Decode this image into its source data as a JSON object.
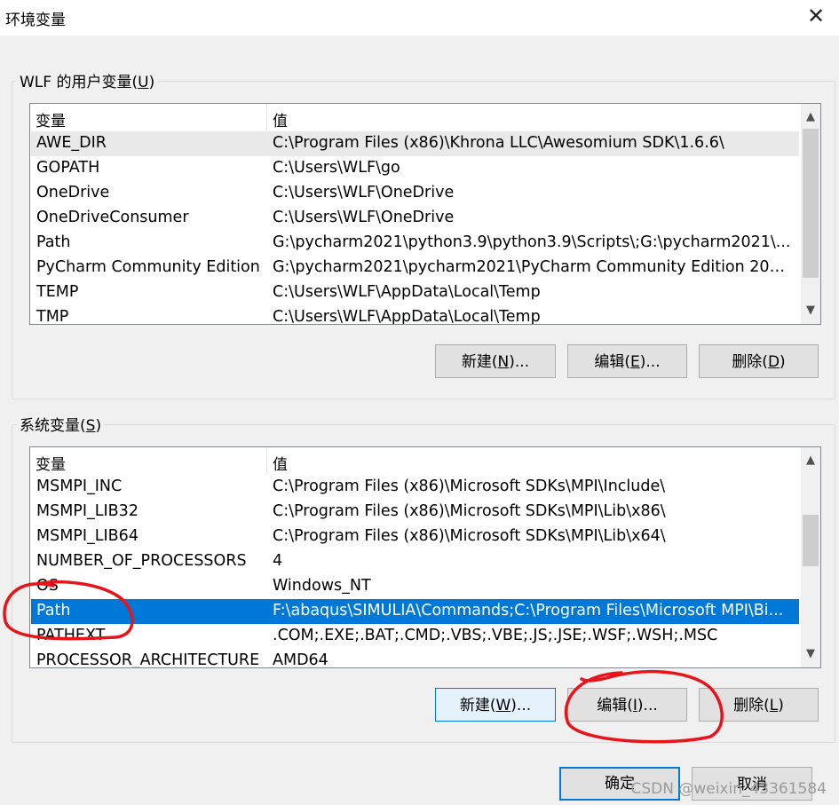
{
  "window": {
    "title": "环境变量",
    "close_glyph": "✕"
  },
  "user_group": {
    "label": "WLF 的用户变量(U)",
    "headers": {
      "name": "变量",
      "value": "值"
    },
    "rows": [
      {
        "name": "AWE_DIR",
        "value": "C:\\Program Files (x86)\\Khrona LLC\\Awesomium SDK\\1.6.6\\"
      },
      {
        "name": "GOPATH",
        "value": "C:\\Users\\WLF\\go"
      },
      {
        "name": "OneDrive",
        "value": "C:\\Users\\WLF\\OneDrive"
      },
      {
        "name": "OneDriveConsumer",
        "value": "C:\\Users\\WLF\\OneDrive"
      },
      {
        "name": "Path",
        "value": "G:\\pycharm2021\\python3.9\\python3.9\\Scripts\\;G:\\pycharm2021\\..."
      },
      {
        "name": "PyCharm Community Edition",
        "value": "G:\\pycharm2021\\pycharm2021\\PyCharm Community Edition 202..."
      },
      {
        "name": "TEMP",
        "value": "C:\\Users\\WLF\\AppData\\Local\\Temp"
      },
      {
        "name": "TMP",
        "value": "C:\\Users\\WLF\\AppData\\Local\\Temp"
      }
    ],
    "buttons": {
      "new": "新建(N)...",
      "edit": "编辑(E)...",
      "delete": "删除(D)"
    }
  },
  "system_group": {
    "label": "系统变量(S)",
    "headers": {
      "name": "变量",
      "value": "值"
    },
    "rows": [
      {
        "name": "MSMPI_INC",
        "value": "C:\\Program Files (x86)\\Microsoft SDKs\\MPI\\Include\\"
      },
      {
        "name": "MSMPI_LIB32",
        "value": "C:\\Program Files (x86)\\Microsoft SDKs\\MPI\\Lib\\x86\\"
      },
      {
        "name": "MSMPI_LIB64",
        "value": "C:\\Program Files (x86)\\Microsoft SDKs\\MPI\\Lib\\x64\\"
      },
      {
        "name": "NUMBER_OF_PROCESSORS",
        "value": "4"
      },
      {
        "name": "OS",
        "value": "Windows_NT"
      },
      {
        "name": "Path",
        "value": "F:\\abaqus\\SIMULIA\\Commands;C:\\Program Files\\Microsoft MPI\\Bi..."
      },
      {
        "name": "PATHEXT",
        "value": ".COM;.EXE;.BAT;.CMD;.VBS;.VBE;.JS;.JSE;.WSF;.WSH;.MSC"
      },
      {
        "name": "PROCESSOR_ARCHITECTURE",
        "value": "AMD64"
      }
    ],
    "selected_row": "Path",
    "buttons": {
      "new": "新建(W)...",
      "edit": "编辑(I)...",
      "delete": "删除(L)"
    }
  },
  "footer": {
    "ok": "确定",
    "cancel": "取消"
  },
  "watermark": "CSDN @weixin_43361584",
  "colors": {
    "selection": "#0078d7",
    "annotation": "#e8141b"
  }
}
